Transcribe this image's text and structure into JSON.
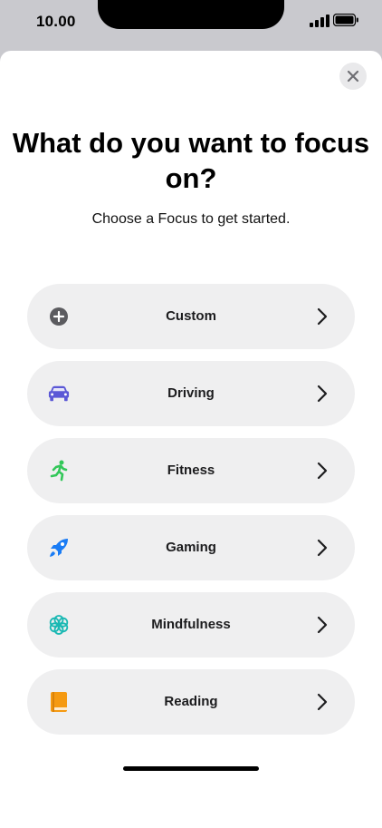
{
  "status_bar": {
    "time": "10.00"
  },
  "header": {
    "title": "What do you want to focus on?",
    "subtitle": "Choose a Focus to get started."
  },
  "options": [
    {
      "label": "Custom",
      "icon": "plus-circle-icon",
      "color": "#5b5b5f"
    },
    {
      "label": "Driving",
      "icon": "car-icon",
      "color": "#5b58d6"
    },
    {
      "label": "Fitness",
      "icon": "running-icon",
      "color": "#32c759"
    },
    {
      "label": "Gaming",
      "icon": "rocket-icon",
      "color": "#1a7cf5"
    },
    {
      "label": "Mindfulness",
      "icon": "flower-icon",
      "color": "#19b8b3"
    },
    {
      "label": "Reading",
      "icon": "book-icon",
      "color": "#f59a12"
    }
  ]
}
